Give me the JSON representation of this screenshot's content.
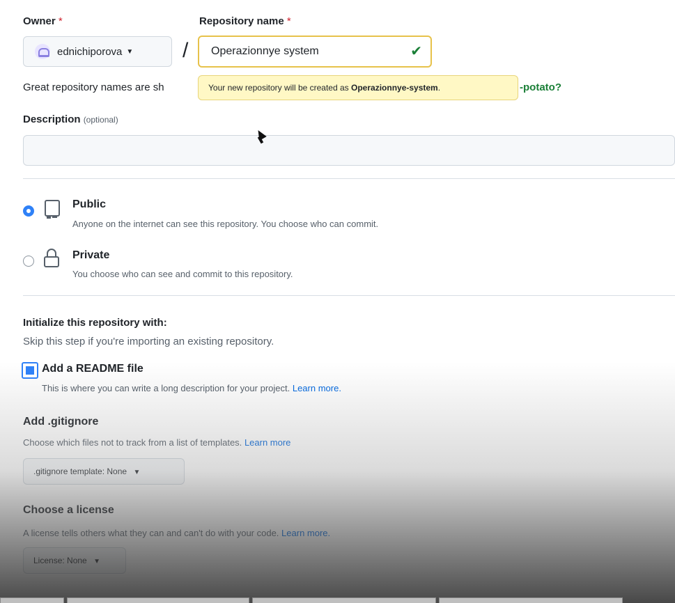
{
  "owner": {
    "label": "Owner",
    "required_mark": "*",
    "value": "ednichiporova",
    "avatar_icon": "identicon-avatar",
    "caret_icon": "caret-down-icon"
  },
  "separator": "/",
  "repo": {
    "label": "Repository name",
    "required_mark": "*",
    "value": "Operazionnye system",
    "valid_icon": "check-icon",
    "valid_color": "#1a7f37"
  },
  "tooltip": {
    "prefix": "Your new repository will be created as",
    "name": "Operazionnye-system",
    "suffix": "."
  },
  "hint": {
    "visible_start": "Great repository names are sh",
    "visible_end": "-potato?"
  },
  "description": {
    "label": "Description",
    "optional": "(optional)",
    "value": ""
  },
  "visibility": {
    "public": {
      "title": "Public",
      "subtitle": "Anyone on the internet can see this repository. You choose who can commit.",
      "icon": "repo-icon",
      "selected": true
    },
    "private": {
      "title": "Private",
      "subtitle": "You choose who can see and commit to this repository.",
      "icon": "lock-icon",
      "selected": false
    }
  },
  "init": {
    "title": "Initialize this repository with:",
    "subtitle": "Skip this step if you're importing an existing repository.",
    "readme": {
      "label": "Add a README file",
      "description": "This is where you can write a long description for your project.",
      "link": "Learn more.",
      "checked": true
    }
  },
  "gitignore": {
    "title": "Add .gitignore",
    "description": "Choose which files not to track from a list of templates.",
    "link": "Learn more",
    "button": ".gitignore template: None"
  },
  "license": {
    "title": "Choose a license",
    "description": "A license tells others what they can and can't do with your code.",
    "link": "Learn more.",
    "button": "License: None"
  },
  "colors": {
    "accent": "#2f81f7",
    "tooltip_bg": "#fff8c5",
    "link": "#0969da"
  }
}
